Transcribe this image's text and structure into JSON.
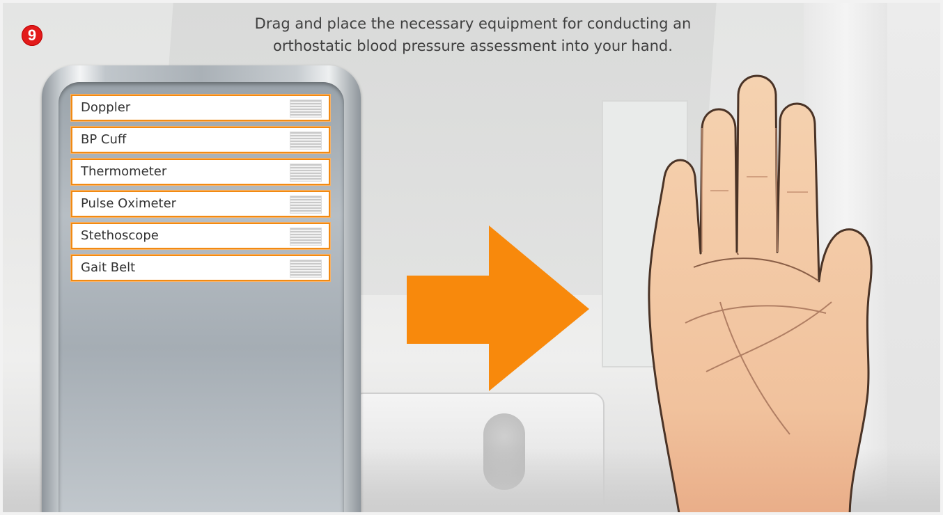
{
  "step": {
    "number": "9",
    "badge_color": "#e31b1b"
  },
  "instruction": {
    "line1": "Drag and place the necessary equipment for conducting an",
    "line2": "orthostatic blood pressure assessment into your hand."
  },
  "equipment_tray": {
    "items": [
      {
        "label": "Doppler"
      },
      {
        "label": "BP Cuff"
      },
      {
        "label": "Thermometer"
      },
      {
        "label": "Pulse Oximeter"
      },
      {
        "label": "Stethoscope"
      },
      {
        "label": "Gait Belt"
      }
    ],
    "item_border_color": "#f28a12",
    "drag_handle_icon": "grip-lines-icon"
  },
  "arrow": {
    "icon": "arrow-right-icon",
    "color": "#f8890c"
  },
  "drop_target": {
    "icon": "open-hand-icon",
    "skin_color": "#f4c9a3"
  }
}
